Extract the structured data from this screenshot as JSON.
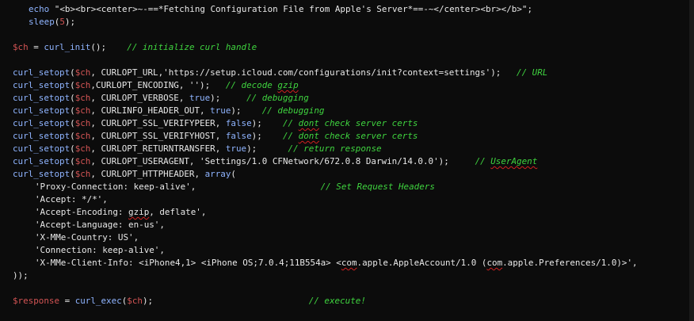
{
  "colors": {
    "background": "#0c0c0c",
    "text": "#e8e8e8",
    "function": "#8fb4ff",
    "variable": "#d35454",
    "comment": "#3fd43f",
    "spellcheck": "#d02020"
  },
  "code": {
    "lines": [
      {
        "indent": 1,
        "tokens": [
          {
            "t": "func",
            "v": "echo"
          },
          {
            "t": "string",
            "v": " \"<b><br><center>~-==*Fetching Configuration File from Apple's Server*==-~</center><br></b>\";"
          }
        ]
      },
      {
        "indent": 1,
        "tokens": [
          {
            "t": "func",
            "v": "sleep"
          },
          {
            "t": "default",
            "v": "("
          },
          {
            "t": "number",
            "v": "5"
          },
          {
            "t": "default",
            "v": ");"
          }
        ]
      },
      {
        "indent": 0,
        "tokens": []
      },
      {
        "indent": 0,
        "tokens": [
          {
            "t": "var",
            "v": "$ch"
          },
          {
            "t": "default",
            "v": " = "
          },
          {
            "t": "func",
            "v": "curl_init"
          },
          {
            "t": "default",
            "v": "();    "
          },
          {
            "t": "comment",
            "v": "// initialize curl handle"
          }
        ]
      },
      {
        "indent": 0,
        "tokens": []
      },
      {
        "indent": 0,
        "tokens": [
          {
            "t": "func",
            "v": "curl_setopt"
          },
          {
            "t": "default",
            "v": "("
          },
          {
            "t": "var",
            "v": "$ch"
          },
          {
            "t": "default",
            "v": ", CURLOPT_URL,'https://setup.icloud.com/configurations/init?context=settings');   "
          },
          {
            "t": "comment",
            "v": "// URL"
          }
        ]
      },
      {
        "indent": 0,
        "tokens": [
          {
            "t": "func",
            "v": "curl_setopt"
          },
          {
            "t": "default",
            "v": "("
          },
          {
            "t": "var",
            "v": "$ch"
          },
          {
            "t": "default",
            "v": ",CURLOPT_ENCODING, '');   "
          },
          {
            "t": "comment",
            "v": "// decode "
          },
          {
            "t": "comment",
            "v": "gzip",
            "spell": true
          }
        ]
      },
      {
        "indent": 0,
        "tokens": [
          {
            "t": "func",
            "v": "curl_setopt"
          },
          {
            "t": "default",
            "v": "("
          },
          {
            "t": "var",
            "v": "$ch"
          },
          {
            "t": "default",
            "v": ", CURLOPT_VERBOSE, "
          },
          {
            "t": "keyword",
            "v": "true"
          },
          {
            "t": "default",
            "v": ");     "
          },
          {
            "t": "comment",
            "v": "// debugging"
          }
        ]
      },
      {
        "indent": 0,
        "tokens": [
          {
            "t": "func",
            "v": "curl_setopt"
          },
          {
            "t": "default",
            "v": "("
          },
          {
            "t": "var",
            "v": "$ch"
          },
          {
            "t": "default",
            "v": ", CURLINFO_HEADER_OUT, "
          },
          {
            "t": "keyword",
            "v": "true"
          },
          {
            "t": "default",
            "v": ");    "
          },
          {
            "t": "comment",
            "v": "// debugging"
          }
        ]
      },
      {
        "indent": 0,
        "tokens": [
          {
            "t": "func",
            "v": "curl_setopt"
          },
          {
            "t": "default",
            "v": "("
          },
          {
            "t": "var",
            "v": "$ch"
          },
          {
            "t": "default",
            "v": ", CURLOPT_SSL_VERIFYPEER, "
          },
          {
            "t": "keyword",
            "v": "false"
          },
          {
            "t": "default",
            "v": ");    "
          },
          {
            "t": "comment",
            "v": "// "
          },
          {
            "t": "comment",
            "v": "dont",
            "spell": true
          },
          {
            "t": "comment",
            "v": " check server certs"
          }
        ]
      },
      {
        "indent": 0,
        "tokens": [
          {
            "t": "func",
            "v": "curl_setopt"
          },
          {
            "t": "default",
            "v": "("
          },
          {
            "t": "var",
            "v": "$ch"
          },
          {
            "t": "default",
            "v": ", CURLOPT_SSL_VERIFYHOST, "
          },
          {
            "t": "keyword",
            "v": "false"
          },
          {
            "t": "default",
            "v": ");    "
          },
          {
            "t": "comment",
            "v": "// "
          },
          {
            "t": "comment",
            "v": "dont",
            "spell": true
          },
          {
            "t": "comment",
            "v": " check server certs"
          }
        ]
      },
      {
        "indent": 0,
        "tokens": [
          {
            "t": "func",
            "v": "curl_setopt"
          },
          {
            "t": "default",
            "v": "("
          },
          {
            "t": "var",
            "v": "$ch"
          },
          {
            "t": "default",
            "v": ", CURLOPT_RETURNTRANSFER, "
          },
          {
            "t": "keyword",
            "v": "true"
          },
          {
            "t": "default",
            "v": ");      "
          },
          {
            "t": "comment",
            "v": "// return response"
          }
        ]
      },
      {
        "indent": 0,
        "tokens": [
          {
            "t": "func",
            "v": "curl_setopt"
          },
          {
            "t": "default",
            "v": "("
          },
          {
            "t": "var",
            "v": "$ch"
          },
          {
            "t": "default",
            "v": ", CURLOPT_USERAGENT, 'Settings/1.0 CFNetwork/672.0.8 Darwin/14.0.0');     "
          },
          {
            "t": "comment",
            "v": "// "
          },
          {
            "t": "comment",
            "v": "UserAgent",
            "spell": true
          }
        ]
      },
      {
        "indent": 0,
        "tokens": [
          {
            "t": "func",
            "v": "curl_setopt"
          },
          {
            "t": "default",
            "v": "("
          },
          {
            "t": "var",
            "v": "$ch"
          },
          {
            "t": "default",
            "v": ", CURLOPT_HTTPHEADER, "
          },
          {
            "t": "keyword",
            "v": "array"
          },
          {
            "t": "default",
            "v": "("
          }
        ]
      },
      {
        "indent": 2,
        "tokens": [
          {
            "t": "string",
            "v": "'Proxy-Connection: keep-alive',                        "
          },
          {
            "t": "comment",
            "v": "// Set Request Headers"
          }
        ]
      },
      {
        "indent": 2,
        "tokens": [
          {
            "t": "string",
            "v": "'Accept: */*',"
          }
        ]
      },
      {
        "indent": 2,
        "tokens": [
          {
            "t": "string",
            "v": "'Accept-Encoding: "
          },
          {
            "t": "string",
            "v": "gzip",
            "spell": true
          },
          {
            "t": "string",
            "v": ", deflate',"
          }
        ]
      },
      {
        "indent": 2,
        "tokens": [
          {
            "t": "string",
            "v": "'Accept-Language: en-us',"
          }
        ]
      },
      {
        "indent": 2,
        "tokens": [
          {
            "t": "string",
            "v": "'X-MMe-Country: US',"
          }
        ]
      },
      {
        "indent": 2,
        "tokens": [
          {
            "t": "string",
            "v": "'Connection: keep-alive',"
          }
        ]
      },
      {
        "indent": 2,
        "tokens": [
          {
            "t": "string",
            "v": "'X-MMe-Client-Info: <iPhone4,1> <iPhone OS;7.0.4;11B554a> <"
          },
          {
            "t": "string",
            "v": "com",
            "spell": true
          },
          {
            "t": "string",
            "v": ".apple.AppleAccount/1.0 ("
          },
          {
            "t": "string",
            "v": "com",
            "spell": true
          },
          {
            "t": "string",
            "v": ".apple.Preferences/1.0)>',"
          }
        ]
      },
      {
        "indent": 0,
        "tokens": [
          {
            "t": "default",
            "v": "));"
          }
        ]
      },
      {
        "indent": 0,
        "tokens": []
      },
      {
        "indent": 0,
        "tokens": [
          {
            "t": "var",
            "v": "$response"
          },
          {
            "t": "default",
            "v": " = "
          },
          {
            "t": "func",
            "v": "curl_exec"
          },
          {
            "t": "default",
            "v": "("
          },
          {
            "t": "var",
            "v": "$ch"
          },
          {
            "t": "default",
            "v": ");                              "
          },
          {
            "t": "comment",
            "v": "// execute!"
          }
        ]
      }
    ]
  }
}
